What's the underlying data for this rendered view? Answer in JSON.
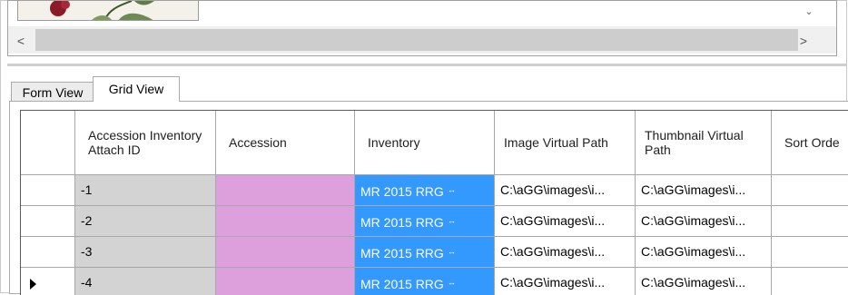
{
  "scroll": {
    "left_arrow": "<",
    "right_arrow": ">",
    "down_arrow": "⌄"
  },
  "tabs": [
    {
      "label": "Form View",
      "active": false
    },
    {
      "label": "Grid View",
      "active": true
    }
  ],
  "grid": {
    "columns": [
      "Accession Inventory Attach ID",
      "Accession",
      "Inventory",
      "Image Virtual Path",
      "Thumbnail Virtual Path",
      "Sort Orde"
    ],
    "rows": [
      {
        "id": "-1",
        "accession": "",
        "inventory": "MR 2015 RRG",
        "image_path": "C:\\aGG\\images\\i...",
        "thumb_path": "C:\\aGG\\images\\i...",
        "sort_order": ""
      },
      {
        "id": "-2",
        "accession": "",
        "inventory": "MR 2015 RRG",
        "image_path": "C:\\aGG\\images\\i...",
        "thumb_path": "C:\\aGG\\images\\i...",
        "sort_order": ""
      },
      {
        "id": "-3",
        "accession": "",
        "inventory": "MR 2015 RRG",
        "image_path": "C:\\aGG\\images\\i...",
        "thumb_path": "C:\\aGG\\images\\i...",
        "sort_order": ""
      },
      {
        "id": "-4",
        "accession": "",
        "inventory": "MR 2015 RRG",
        "image_path": "C:\\aGG\\images\\i...",
        "thumb_path": "C:\\aGG\\images\\i...",
        "sort_order": ""
      }
    ],
    "current_row_marker": "▶",
    "lookup_glyph": "↔"
  },
  "colors": {
    "id_cell": "#d3d3d3",
    "accession_cell": "#dda0dd",
    "inventory_cell": "#3399ff"
  }
}
